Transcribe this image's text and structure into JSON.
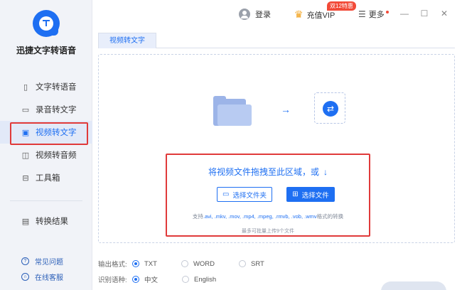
{
  "app": {
    "name": "迅捷文字转语音",
    "accent_color": "#1e6ff2",
    "highlight_color": "#e03a3a"
  },
  "titlebar": {
    "login_label": "登录",
    "vip_label": "充值VIP",
    "vip_badge": "双12特惠",
    "more_label": "更多",
    "minimize_icon": "minimize-icon",
    "maximize_icon": "maximize-icon",
    "close_icon": "close-icon"
  },
  "sidebar": {
    "items": [
      {
        "label": "文字转语音",
        "icon": "text-to-speech-icon",
        "active": false
      },
      {
        "label": "录音转文字",
        "icon": "recording-icon",
        "active": false
      },
      {
        "label": "视频转文字",
        "icon": "video-icon",
        "active": true
      },
      {
        "label": "视频转音频",
        "icon": "video-audio-icon",
        "active": false
      },
      {
        "label": "工具箱",
        "icon": "toolbox-icon",
        "active": false
      }
    ],
    "result_label": "转换结果",
    "help": [
      {
        "label": "常见问题",
        "icon": "question-icon"
      },
      {
        "label": "在线客服",
        "icon": "headset-icon"
      }
    ]
  },
  "tabs": [
    {
      "label": "视频转文字",
      "active": true
    }
  ],
  "dropzone": {
    "drag_text": "将视频文件拖拽至此区域，或",
    "choose_folder_label": "选择文件夹",
    "choose_file_label": "选择文件",
    "formats_prefix": "支持",
    "formats_list": ".avi, .mkv, .mov, .mp4, .mpeg, .rmvb, .vob, .wmv",
    "formats_suffix": "格式的转换",
    "limit_text": "最多可批量上传9个文件"
  },
  "options": {
    "output_label": "输出格式:",
    "output_choices": [
      {
        "label": "TXT",
        "selected": true
      },
      {
        "label": "WORD",
        "selected": false
      },
      {
        "label": "SRT",
        "selected": false
      }
    ],
    "language_label": "识别语种:",
    "language_choices": [
      {
        "label": "中文",
        "selected": true
      },
      {
        "label": "English",
        "selected": false
      }
    ]
  }
}
